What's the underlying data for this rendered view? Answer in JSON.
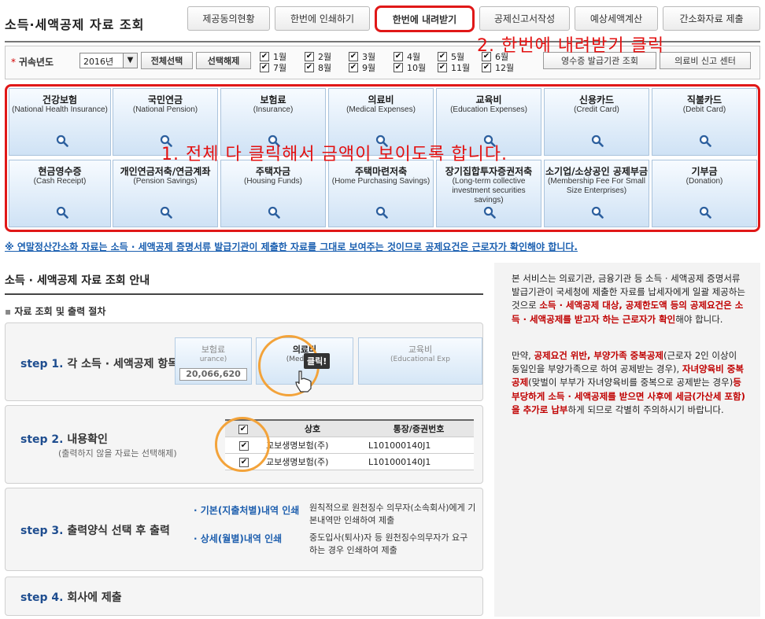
{
  "page_title": "소득·세액공제 자료 조회",
  "top_buttons": [
    {
      "label": "제공동의현황"
    },
    {
      "label": "한번에 인쇄하기"
    },
    {
      "label": "한번에 내려받기"
    },
    {
      "label": "공제신고서작성"
    },
    {
      "label": "예상세액계산"
    },
    {
      "label": "간소화자료 제출"
    }
  ],
  "annotation2": "2. 한번에 내려받기 클릭",
  "filter": {
    "year_label": "귀속년도",
    "year_value": "2016년",
    "select_all": "전체선택",
    "deselect": "선택해제",
    "months": [
      "1월",
      "2월",
      "3월",
      "4월",
      "5월",
      "6월",
      "7월",
      "8월",
      "9월",
      "10월",
      "11월",
      "12월"
    ],
    "receipt_btn": "영수증 발급기관 조회",
    "medical_btn": "의료비 신고 센터"
  },
  "tiles": [
    {
      "ko": "건강보험",
      "en": "(National Health Insurance)"
    },
    {
      "ko": "국민연금",
      "en": "(National Pension)"
    },
    {
      "ko": "보험료",
      "en": "(Insurance)"
    },
    {
      "ko": "의료비",
      "en": "(Medical Expenses)"
    },
    {
      "ko": "교육비",
      "en": "(Education Expenses)"
    },
    {
      "ko": "신용카드",
      "en": "(Credit Card)"
    },
    {
      "ko": "직불카드",
      "en": "(Debit Card)"
    },
    {
      "ko": "현금영수증",
      "en": "(Cash Receipt)"
    },
    {
      "ko": "개인연금저축/연금계좌",
      "en": "(Pension Savings)"
    },
    {
      "ko": "주택자금",
      "en": "(Housing Funds)"
    },
    {
      "ko": "주택마련저축",
      "en": "(Home Purchasing Savings)"
    },
    {
      "ko": "장기집합투자증권저축",
      "en": "(Long-term collective investment securities savings)"
    },
    {
      "ko": "소기업/소상공인 공제부금",
      "en": "(Membership Fee For Small Size Enterprises)"
    },
    {
      "ko": "기부금",
      "en": "(Donation)"
    }
  ],
  "annotation1": "1. 전체 다 클릭해서 금액이 보이도록 합니다.",
  "notice": "※ 연말정산간소화 자료는 소득 · 세액공제 증명서류 발급기관이 제출한 자료를 그대로 보여주는 것이므로 공제요건은 근로자가 확인해야 합니다.",
  "guide": {
    "title": "소득 · 세액공제 자료 조회 안내",
    "subtitle": "자료 조회 및 출력 절차",
    "step1": {
      "num": "step 1.",
      "text": "각 소득 · 세액공제 항목 클릭",
      "tile_a": "보험료",
      "tile_a_en": "urance)",
      "amount": "20,066,620",
      "tile_b": "의료비",
      "tile_b_en": "(Medical E",
      "tile_c": "교육비",
      "tile_c_en": "(Educational Exp",
      "click": "클릭!"
    },
    "step2": {
      "num": "step 2.",
      "text": "내용확인",
      "sub": "(출력하지 않을 자료는 선택해제)",
      "col1": "상호",
      "col2": "통장/증권번호",
      "rows": [
        [
          "교보생명보험(주)",
          "L101000140J1"
        ],
        [
          "교보생명보험(주)",
          "L101000140J1"
        ]
      ]
    },
    "step3": {
      "num": "step 3.",
      "text": "출력양식 선택 후 출력",
      "opt1": "· 기본(지출처별)내역 인쇄",
      "opt1_desc": "원칙적으로 원천징수 의무자(소속회사)에게 기본내역만 인쇄하여 제출",
      "opt2": "· 상세(월별)내역 인쇄",
      "opt2_desc": "중도입사(퇴사)자 등 원천징수의무자가 요구하는 경우 인쇄하여 제출"
    },
    "step4": {
      "num": "step 4.",
      "text": "회사에 제출"
    }
  },
  "info": {
    "p1a": "본 서비스는 의료기관, 금융기관 등 소득 · 세액공제 증명서류 발급기관이 국세청에 제출한 자료를 납세자에게 일괄 제공하는 것으로 ",
    "p1b": "소득 · 세액공제 대상, 공제한도액 등의 공제요건은 소득 · 세액공제를 받고자 하는 근로자가 확인",
    "p1c": "해야 합니다.",
    "p2a": "만약, ",
    "p2b": "공제요건 위반, 부양가족 중복공제",
    "p2c": "(근로자 2인 이상이 동일인을 부양가족으로 하여 공제받는 경우), ",
    "p2d": "자녀양육비 중복공제",
    "p2e": "(맞벌이 부부가 자녀양육비를 중복으로 공제받는 경우)",
    "p2f": "등 부당하게 소득 · 세액공제를 받으면 사후에 세금(가산세 포함)을 추가로 납부",
    "p2g": "하게 되므로 각별히 주의하시기 바랍니다."
  }
}
